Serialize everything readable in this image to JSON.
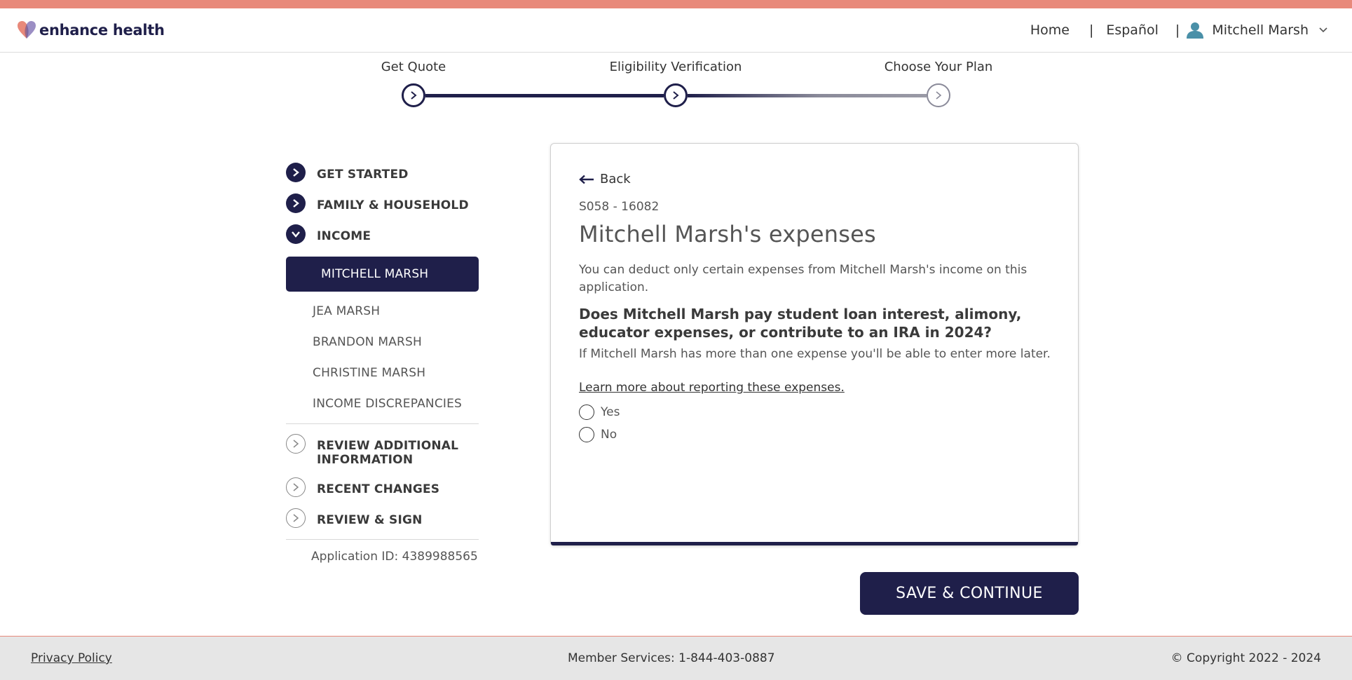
{
  "brand": {
    "name": "enhance health",
    "accent": "#e8897a",
    "primary": "#1f1f4a"
  },
  "nav": {
    "home": "Home",
    "sep": "|",
    "language": "Español",
    "user": "Mitchell Marsh"
  },
  "progress": {
    "steps": [
      {
        "label": "Get Quote",
        "status": "done"
      },
      {
        "label": "Eligibility Verification",
        "status": "current"
      },
      {
        "label": "Choose Your Plan",
        "status": "todo"
      }
    ]
  },
  "sidebar": {
    "get_started": "GET STARTED",
    "family": "FAMILY & HOUSEHOLD",
    "income": "INCOME",
    "income_items": [
      "MITCHELL MARSH",
      "JEA MARSH",
      "BRANDON MARSH",
      "CHRISTINE MARSH",
      "INCOME DISCREPANCIES"
    ],
    "review_additional": "REVIEW ADDITIONAL INFORMATION",
    "recent_changes": "RECENT CHANGES",
    "review_sign": "REVIEW & SIGN",
    "application_id": "Application ID: 4389988565"
  },
  "form": {
    "back": "Back",
    "code": "S058 - 16082",
    "title": "Mitchell Marsh's expenses",
    "description": "You can deduct only certain expenses from Mitchell Marsh's income on this application.",
    "question": "Does Mitchell Marsh pay student loan interest, alimony, educator expenses, or contribute to an IRA in 2024?",
    "hint": "If Mitchell Marsh has more than one expense you'll be able to enter more later.",
    "learn_more": "Learn more about reporting these expenses.",
    "options": [
      "Yes",
      "No"
    ]
  },
  "actions": {
    "save": "SAVE & CONTINUE"
  },
  "footer": {
    "privacy": "Privacy Policy",
    "member_services": "Member Services: 1-844-403-0887",
    "copyright": "© Copyright 2022 - 2024"
  }
}
